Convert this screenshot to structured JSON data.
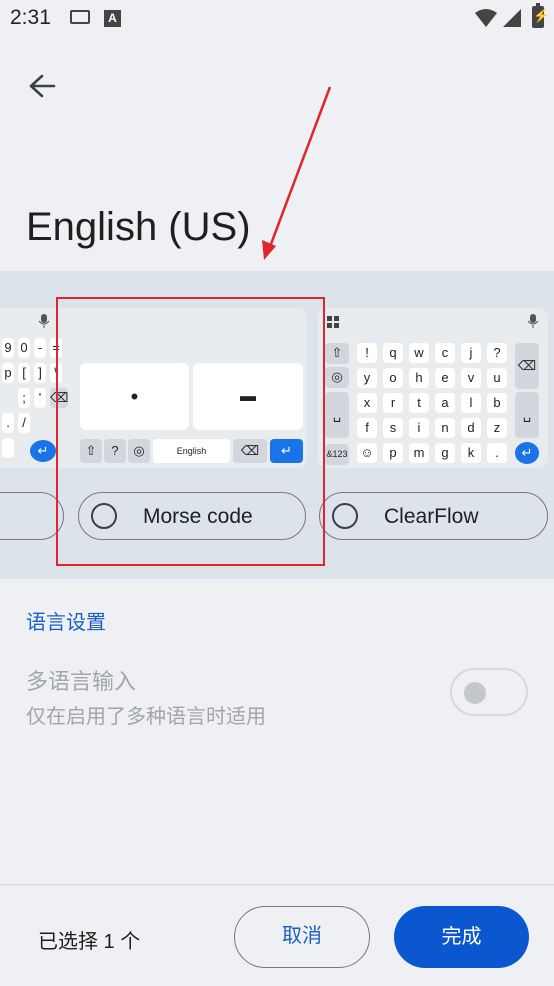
{
  "status_bar": {
    "time": "2:31",
    "keyboard_icon": "keyboard-icon",
    "a_icon": "A",
    "wifi_icon": "wifi-icon",
    "signal_icon": "signal-icon",
    "battery_icon": "battery-charging-icon"
  },
  "header": {
    "back_icon": "arrow-left-icon",
    "title": "English (US)"
  },
  "layouts": {
    "left_keys": [
      "9",
      "0",
      "-",
      "=",
      "p",
      "[",
      "]",
      "\\",
      ";",
      "'",
      ".",
      "/"
    ],
    "middle": {
      "dot": "•",
      "dash": "▬",
      "space_label": "English",
      "icons": [
        "shift-icon",
        "help-icon",
        "globe-icon",
        "backspace-icon",
        "enter-icon"
      ]
    },
    "right_keys": {
      "row1": [
        "!",
        "q",
        "w",
        "c",
        "j",
        "?"
      ],
      "row2": [
        "y",
        "o",
        "h",
        "e",
        "v",
        "u"
      ],
      "row3": [
        "x",
        "r",
        "t",
        "a",
        "l",
        "b"
      ],
      "row4": [
        "f",
        "s",
        "i",
        "n",
        "d",
        "z"
      ],
      "row5": [
        "p",
        "m",
        "g",
        "k",
        "."
      ],
      "symbol_key": "&123"
    },
    "options": [
      {
        "label": ""
      },
      {
        "label": "Morse code"
      },
      {
        "label": "ClearFlow"
      }
    ]
  },
  "settings": {
    "section_header": "语言设置",
    "multilang_title": "多语言输入",
    "multilang_subtitle": "仅在启用了多种语言时适用",
    "multilang_enabled": false
  },
  "footer": {
    "selected_count": "已选择 1 个",
    "cancel_label": "取消",
    "done_label": "完成"
  },
  "colors": {
    "accent": "#0b57d0",
    "link": "#1a5fc8",
    "annotation": "#e0262b",
    "carousel_bg": "#dde3ea"
  }
}
